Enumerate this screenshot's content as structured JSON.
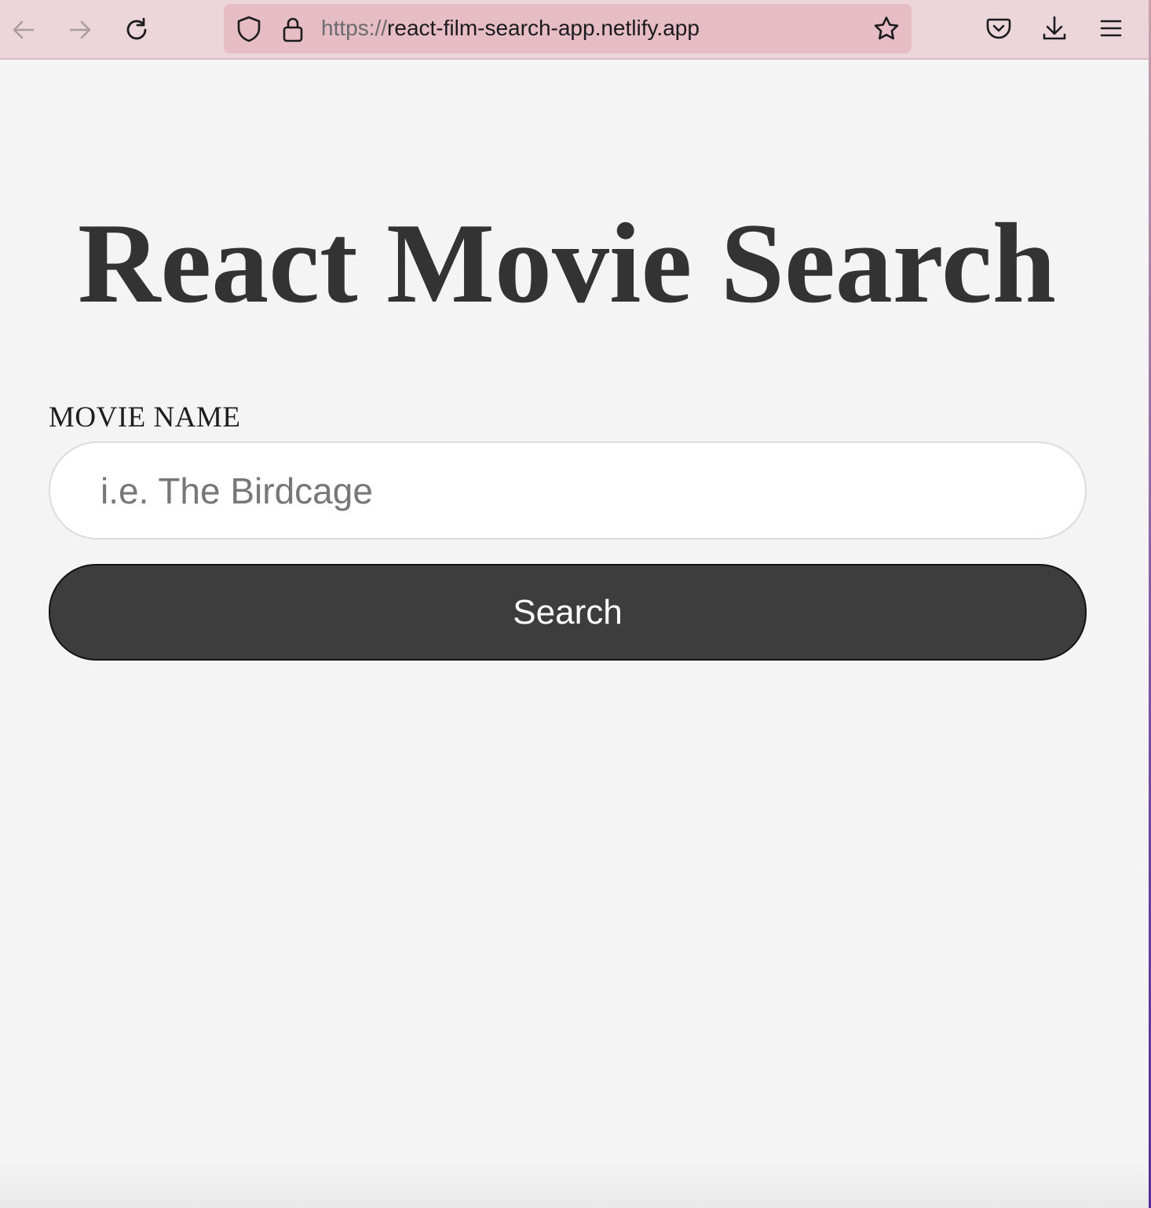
{
  "browser": {
    "url_scheme": "https://",
    "url_host": "react-film-search-app.netlify.app",
    "icons": [
      "back-arrow-icon",
      "forward-arrow-icon",
      "reload-icon",
      "shield-icon",
      "lock-icon",
      "star-icon",
      "pocket-icon",
      "download-icon",
      "menu-icon"
    ]
  },
  "page": {
    "title": "React Movie Search",
    "form": {
      "label": "MOVIE NAME",
      "input_placeholder": "i.e. The Birdcage",
      "input_value": "",
      "button_label": "Search"
    }
  },
  "colors": {
    "toolbar_bg": "#ecd6da",
    "urlbar_bg": "#e6bdc4",
    "page_bg": "#f4f4f4",
    "title_text": "#333333",
    "button_bg": "#3d3d3d",
    "button_text": "#ffffff"
  }
}
